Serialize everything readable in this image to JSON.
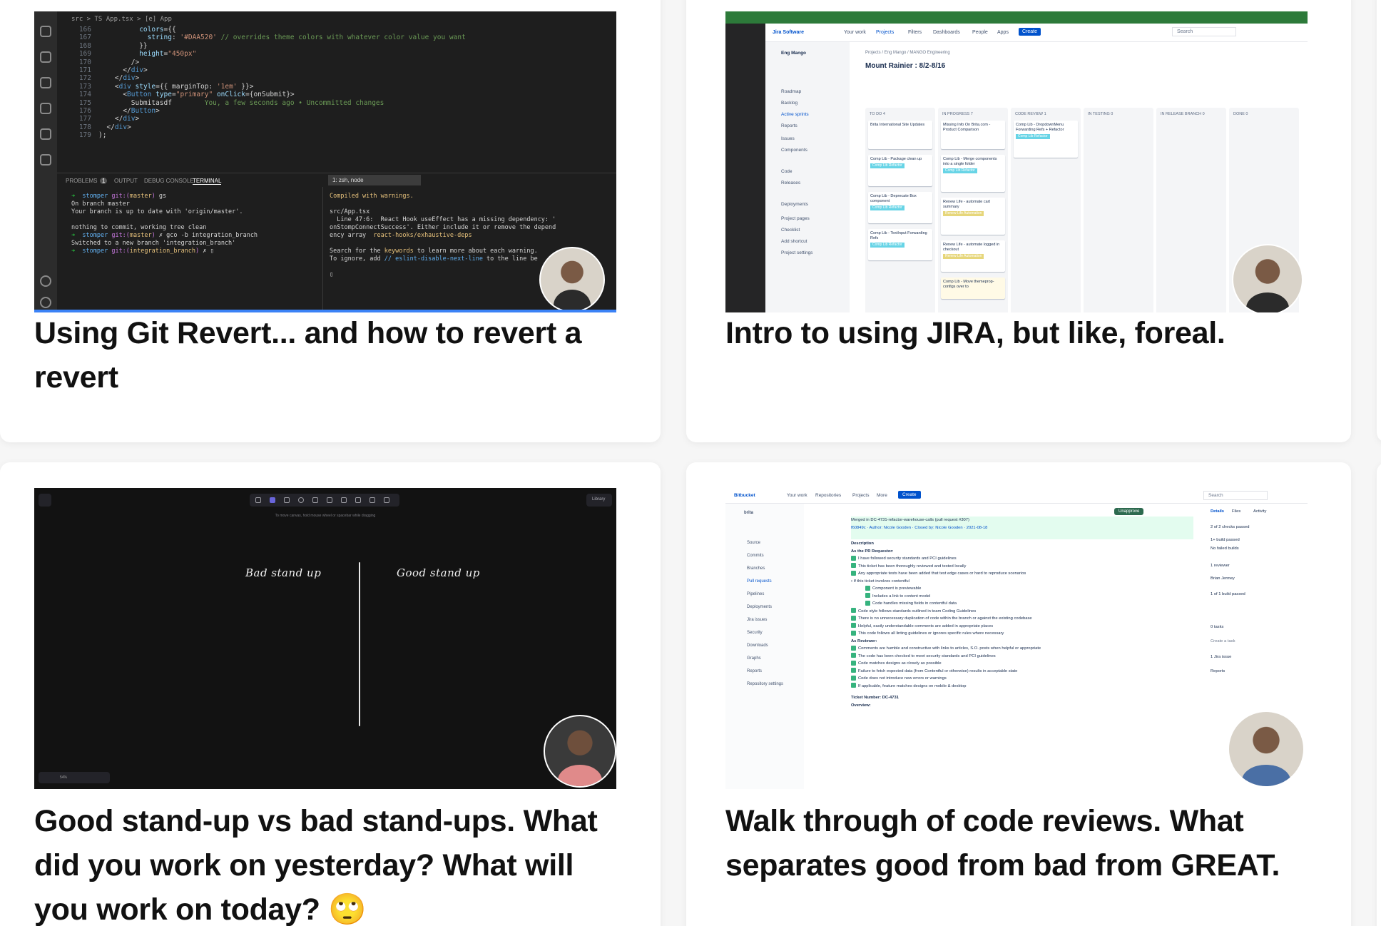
{
  "cards": [
    {
      "title": "Using Git Revert... and how to revert a revert",
      "thumb": {
        "breadcrumb": "src > TS App.tsx > [e] App",
        "panel_tabs": [
          "PROBLEMS",
          "OUTPUT",
          "DEBUG CONSOLE",
          "TERMINAL"
        ],
        "problems_count": "1",
        "terminal_select": "1: zsh, node"
      }
    },
    {
      "title": "Intro to using JIRA, but like, foreal.",
      "thumb": {
        "logo": "Jira Software",
        "nav": [
          "Your work",
          "Projects",
          "Filters",
          "Dashboards",
          "People",
          "Apps"
        ],
        "create": "Create",
        "search": "Search",
        "project": "Eng Mango",
        "board_title": "Mount Rainier : 8/2-8/16",
        "crumbs": "Projects / Eng Mango / MANGO Engineering",
        "sidebar": [
          "Roadmap",
          "Backlog",
          "Active sprints",
          "Reports",
          "Issues",
          "Components",
          "Code",
          "Releases",
          "Deployments",
          "Project pages",
          "Checklist",
          "Add shortcut",
          "Project settings"
        ],
        "columns": [
          "TO DO 4",
          "IN PROGRESS 7",
          "CODE REVIEW 1",
          "IN TESTING 0",
          "IN RELEASE BRANCH 0",
          "DONE 0"
        ]
      }
    },
    {
      "title": "Good stand-up vs bad stand-ups. What did you work on yesterday? What will you work on today? 🙄",
      "thumb": {
        "left_heading": "Bad stand up",
        "right_heading": "Good stand up",
        "hint": "To move canvas, hold mouse wheel or spacebar while dragging",
        "library": "Library",
        "zoom": "54%"
      }
    },
    {
      "title": "Walk through of code reviews. What separates good from bad from GREAT.",
      "thumb": {
        "logo": "Bitbucket",
        "nav": [
          "Your work",
          "Repositories",
          "Projects",
          "More"
        ],
        "create": "Create",
        "search": "Search",
        "repo": "brita",
        "sidebar": [
          "Source",
          "Commits",
          "Branches",
          "Pull requests",
          "Pipelines",
          "Deployments",
          "Jira issues",
          "Security",
          "Downloads",
          "Graphs",
          "Reports",
          "Repository settings"
        ],
        "unapprove": "Unapprove",
        "settings": "Settings",
        "merged_line": "Merged in DC-4731-refactor-warehouse-calls (pull request #307)",
        "author_line": "f60849c · Author: Nicole Gooden · Closed by: Nicole Gooden · 2021-08-18",
        "description": "Description",
        "as_requestor": "As the PR Requestor:",
        "as_reviewer": "As Reviewer:",
        "ticket": "Ticket Number: DC-4731",
        "overview": "Overview:",
        "right_tabs": [
          "Details",
          "Files",
          "Activity"
        ],
        "right_items": [
          "2 of 2 checks passed",
          "1+ build passed",
          "No failed builds",
          "1 reviewer",
          "Brian Jenney",
          "1 of 1 build passed",
          "0 tasks",
          "Create a task",
          "1 Jira issue",
          "Reports"
        ]
      }
    }
  ]
}
